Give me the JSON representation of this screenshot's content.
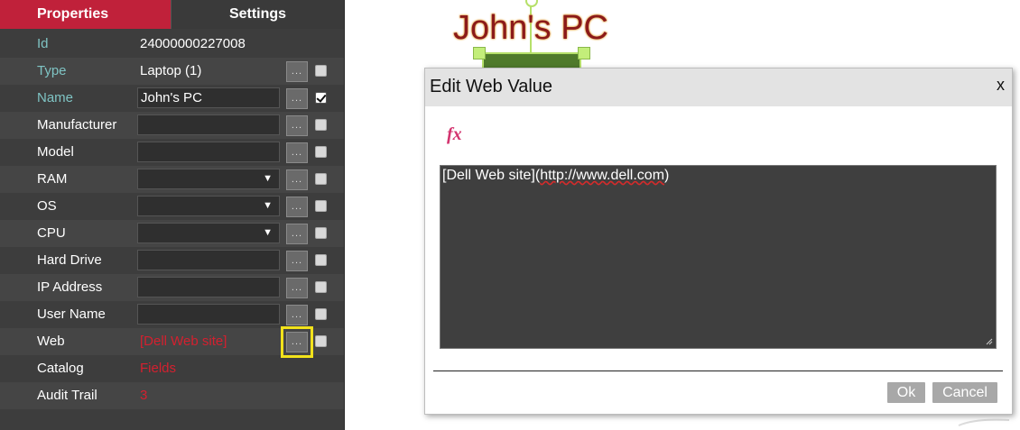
{
  "tabs": {
    "properties": "Properties",
    "settings": "Settings"
  },
  "rows": [
    {
      "label": "Id",
      "value": "24000000227008"
    },
    {
      "label": "Type",
      "value": "Laptop (1)",
      "checked": false
    },
    {
      "label": "Name",
      "value": "John's PC",
      "checked": true
    },
    {
      "label": "Manufacturer",
      "value": "",
      "checked": false
    },
    {
      "label": "Model",
      "value": "",
      "checked": false
    },
    {
      "label": "RAM",
      "value": "",
      "dropdown_arrow": "▼",
      "checked": false
    },
    {
      "label": "OS",
      "value": "",
      "dropdown_arrow": "▼",
      "checked": false
    },
    {
      "label": "CPU",
      "value": "",
      "dropdown_arrow": "▼",
      "checked": false
    },
    {
      "label": "Hard Drive",
      "value": "",
      "checked": false
    },
    {
      "label": "IP Address",
      "value": "",
      "checked": false
    },
    {
      "label": "User Name",
      "value": "",
      "checked": false
    },
    {
      "label": "Web",
      "value": "[Dell Web site]",
      "checked": false
    },
    {
      "label": "Catalog",
      "value": "Fields"
    },
    {
      "label": "Audit Trail",
      "value": "3"
    }
  ],
  "ellipsis_label": "...",
  "canvas": {
    "node_title": "John's PC"
  },
  "dialog": {
    "title": "Edit Web Value",
    "close": "x",
    "fx_icon": "fx",
    "text_part1": "[Dell Web site](",
    "text_link": "http://www.dell.com",
    "text_part2": ")",
    "ok_label": "Ok",
    "cancel_label": "Cancel"
  },
  "colors": {
    "accent": "#c0213a",
    "panel_bg": "#3d3d3d",
    "teal_label": "#7fc4c4",
    "link_red": "#d4202f",
    "highlight": "#f2e21b"
  }
}
